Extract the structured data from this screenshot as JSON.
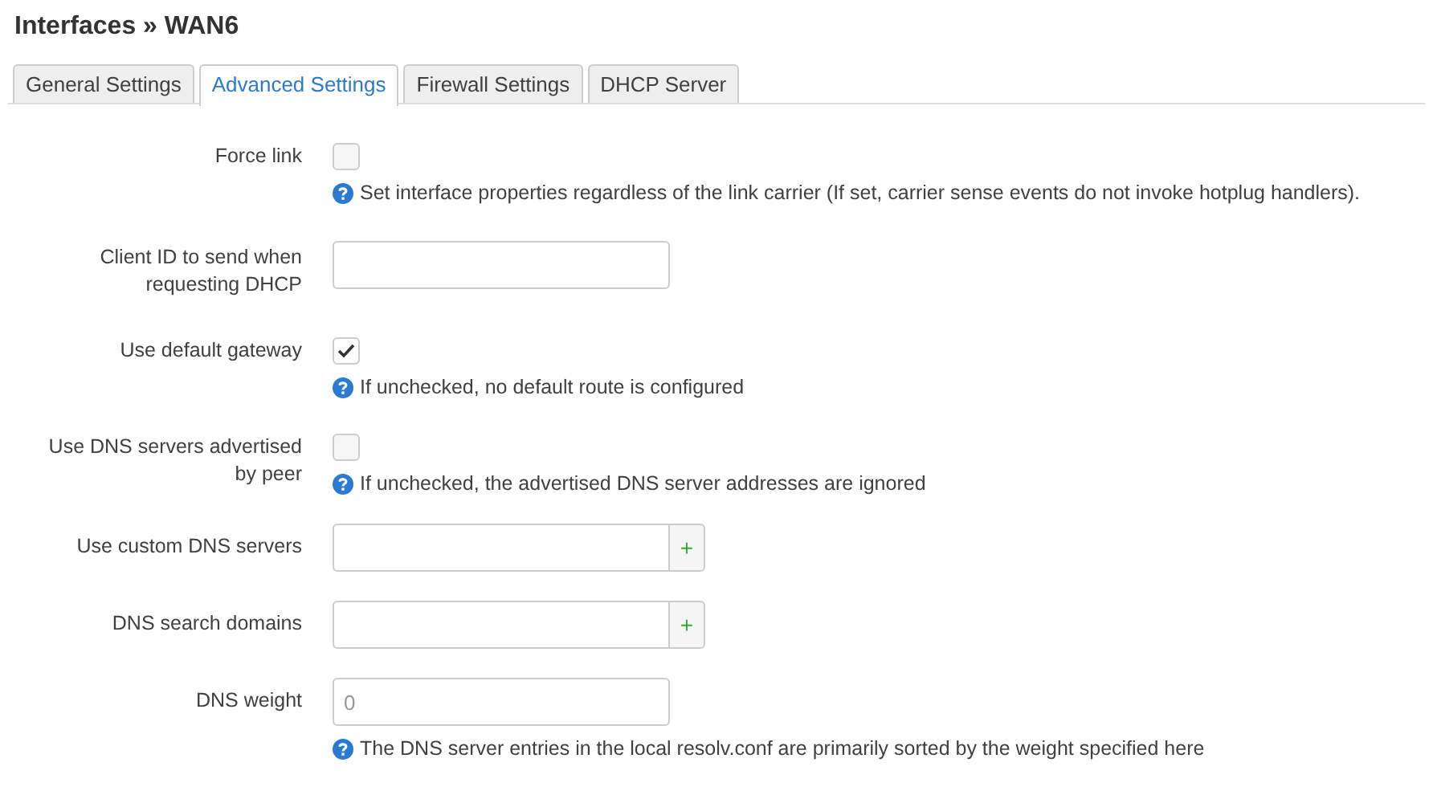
{
  "title": "Interfaces » WAN6",
  "tabs": [
    {
      "label": "General Settings",
      "selected": false
    },
    {
      "label": "Advanced Settings",
      "selected": true
    },
    {
      "label": "Firewall Settings",
      "selected": false
    },
    {
      "label": "DHCP Server",
      "selected": false
    }
  ],
  "fields": [
    {
      "kind": "checkbox",
      "label": "Force link",
      "checked": false,
      "help": "Set interface properties regardless of the link carrier (If set, carrier sense events do not invoke hotplug handlers)."
    },
    {
      "kind": "text",
      "label": "Client ID to send when requesting DHCP"
    },
    {
      "kind": "checkbox",
      "label": "Use default gateway",
      "checked": true,
      "help": "If unchecked, no default route is configured"
    },
    {
      "kind": "checkbox",
      "label": "Use DNS servers advertised by peer",
      "checked": false,
      "help": "If unchecked, the advertised DNS server addresses are ignored"
    },
    {
      "kind": "list",
      "label": "Use custom DNS servers",
      "add_label": "+"
    },
    {
      "kind": "list",
      "label": "DNS search domains",
      "add_label": "+"
    },
    {
      "kind": "text",
      "label": "DNS weight",
      "placeholder": "0",
      "help": "The DNS server entries in the local resolv.conf are primarily sorted by the weight specified here"
    }
  ]
}
